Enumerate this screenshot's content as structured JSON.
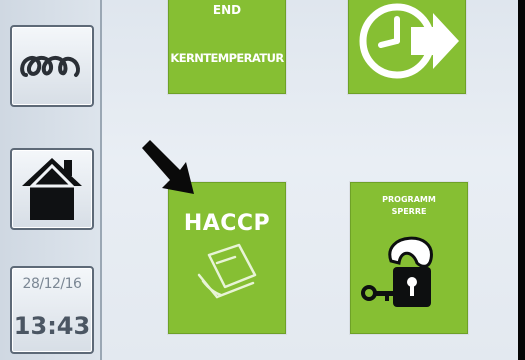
{
  "sidebar": {
    "items": [
      {
        "icon": "heating-coil-icon"
      },
      {
        "icon": "home-icon"
      },
      {
        "date": "28/12/16",
        "time": "13:43"
      }
    ]
  },
  "tiles": {
    "core_temp": {
      "line1": "END",
      "line2": "KERNTEMPERATUR"
    },
    "timer": {
      "icon": "clock-arrow-icon"
    },
    "haccp": {
      "title": "HACCP",
      "icon": "document-check-icon"
    },
    "program_lock": {
      "line1": "PROGRAMM",
      "line2": "SPERRE",
      "icon": "key-lock-icon"
    }
  },
  "colors": {
    "tile_green": "#86bf33",
    "screen_bg": "#e3e9f0",
    "sidebar_border": "#5d6977"
  }
}
